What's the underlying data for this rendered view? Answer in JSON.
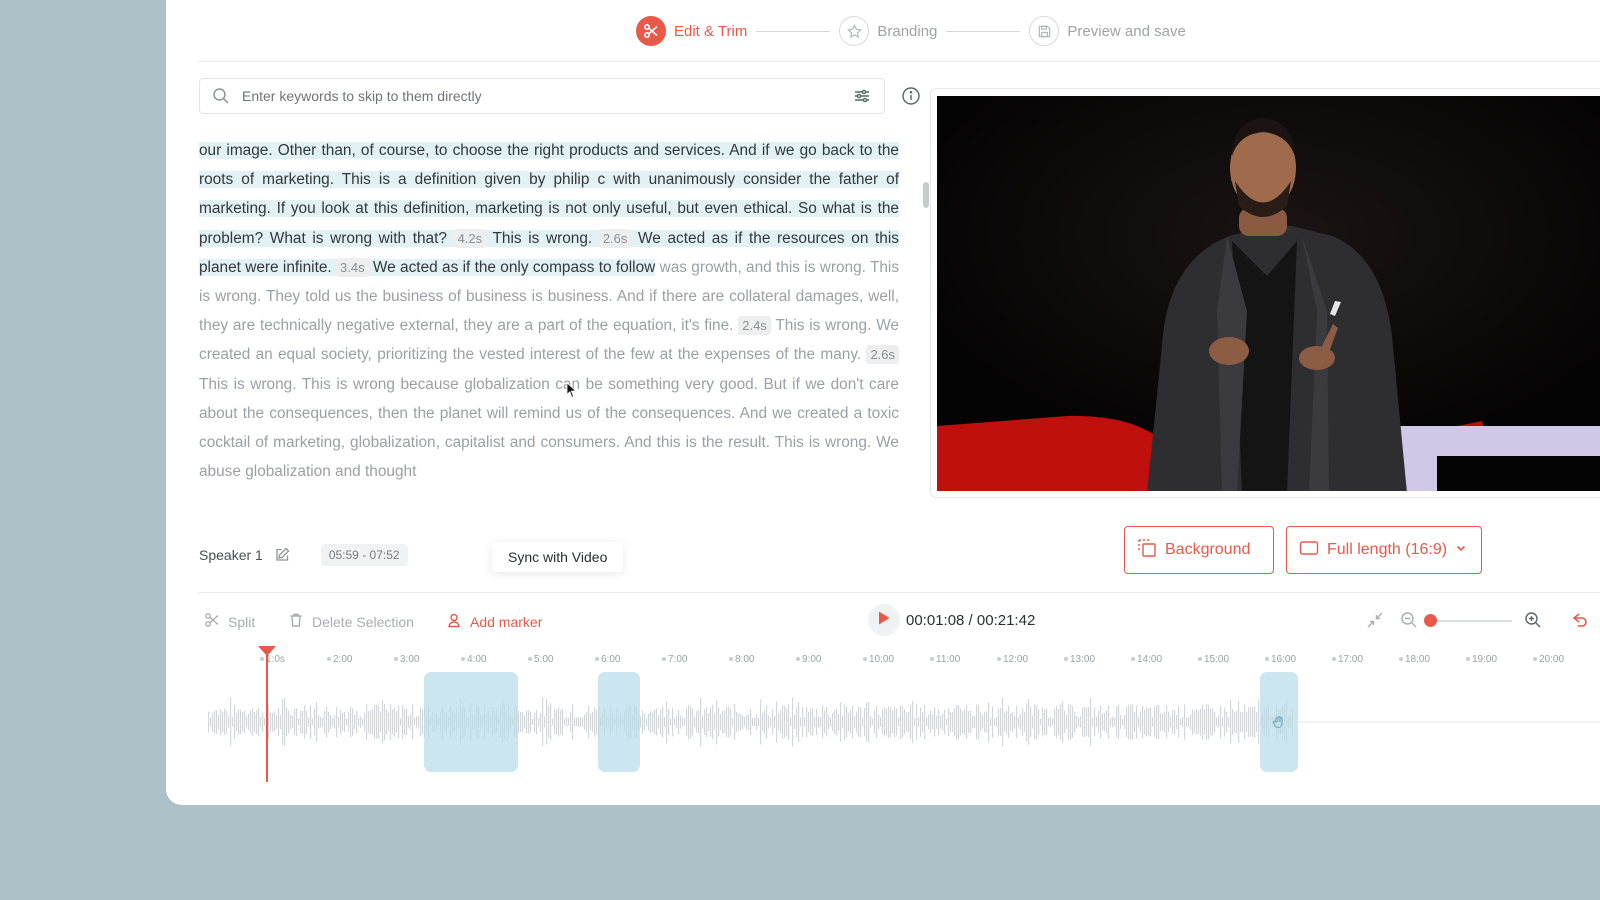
{
  "stepper": {
    "steps": [
      {
        "label": "Edit & Trim",
        "icon": "scissors-icon",
        "active": true
      },
      {
        "label": "Branding",
        "icon": "star-icon",
        "active": false
      },
      {
        "label": "Preview and save",
        "icon": "save-icon",
        "active": false
      }
    ]
  },
  "search": {
    "placeholder": "Enter keywords to skip to them directly"
  },
  "transcript": {
    "s1": "our image. Other than, of course, to choose the right products and services. And if we go back to the roots of marketing. This is a definition given by philip c with unanimously consider the father of marketing. If you look at this definition, marketing is not only useful, but even ethical. So what is the problem? What is wrong with that?",
    "p1": "4.2s",
    "s2": "This is wrong.",
    "p2": "2.6s",
    "s3": "We acted as if the resources on this planet were infinite.",
    "p3": "3.4s",
    "s4": "We acted as if the only compass to follow",
    "s5": "was growth, and this is wrong. This is wrong. They told us the business of business is business. And if there are collateral damages, well, they are technically negative external, they are a part of the equation, it's fine.",
    "p4": "2.4s",
    "s6": "This is wrong. We created an equal society, prioritizing the vested interest of the few at the expenses of the many.",
    "p5": "2.6s",
    "s7": "This is wrong. This is wrong because globalization can be something very good. But if we don't care about the consequences, then the planet will remind us of the consequences. And we created a toxic cocktail of marketing, globalization, capitalist and consumers. And this is the result. This is wrong. We abuse globalization and thought"
  },
  "speaker": {
    "name": "Speaker 1",
    "range": "05:59 - 07:52"
  },
  "tooltip": "Sync with Video",
  "buttons": {
    "background": "Background",
    "aspect": "Full length (16:9)"
  },
  "toolbar": {
    "split": "Split",
    "delete": "Delete Selection",
    "marker": "Add marker"
  },
  "player": {
    "time": "00:01:08 / 00:21:42"
  },
  "timeline": {
    "ticks": [
      "1:0s",
      "2:00",
      "3:00",
      "4:00",
      "5:00",
      "6:00",
      "7:00",
      "8:00",
      "9:00",
      "10:00",
      "11:00",
      "12:00",
      "13:00",
      "14:00",
      "15:00",
      "16:00",
      "17:00",
      "18:00",
      "19:00",
      "20:00"
    ],
    "zoom_level": 0
  },
  "colors": {
    "accent": "#e8594a",
    "highlight": "#e2f1f4",
    "segment": "#b9dee8",
    "backdrop": "#adc1c8"
  }
}
